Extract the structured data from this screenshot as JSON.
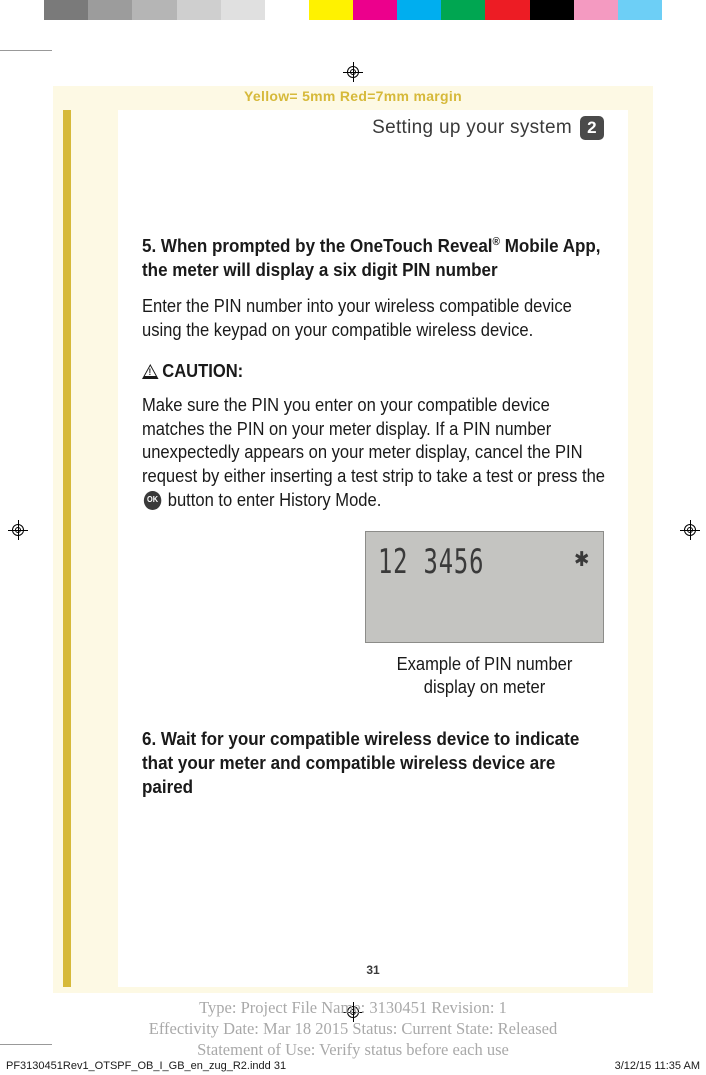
{
  "colorbar": true,
  "margin_label": "Yellow= 5mm  Red=7mm margin",
  "header": {
    "title": "Setting up your system",
    "section_number": "2"
  },
  "step5": {
    "title_a": "5. When prompted by the OneTouch Reveal",
    "title_reg": "®",
    "title_b": " Mobile App, the meter will display a six digit PIN number",
    "para1": "Enter the PIN number into your wireless compatible device using the keypad on your compatible wireless device.",
    "caution_label": "CAUTION:",
    "caution_para_a": "Make sure the PIN you enter on your compatible device matches the PIN on your meter display. If a PIN number unexpectedly appears on your meter display, cancel the PIN request by either inserting a test strip to take a test or press the ",
    "ok_label": "OK",
    "caution_para_b": " button to enter History Mode."
  },
  "lcd": {
    "pin": "12 3456",
    "bluetooth_icon": "✱",
    "caption": "Example of PIN number display on meter"
  },
  "step6": {
    "title": "6. Wait for your compatible wireless device to indicate that your meter and compatible wireless device are paired"
  },
  "page_number": "31",
  "metadata": {
    "line1": "Type: Project File  Name: 3130451  Revision: 1",
    "line2": "Effectivity Date: Mar 18 2015     Status: Current     State: Released",
    "line3": "Statement of Use: Verify status before each use"
  },
  "slug": {
    "file": "PF3130451Rev1_OTSPF_OB_I_GB_en_zug_R2.indd   31",
    "datetime": "3/12/15   11:35 AM"
  }
}
